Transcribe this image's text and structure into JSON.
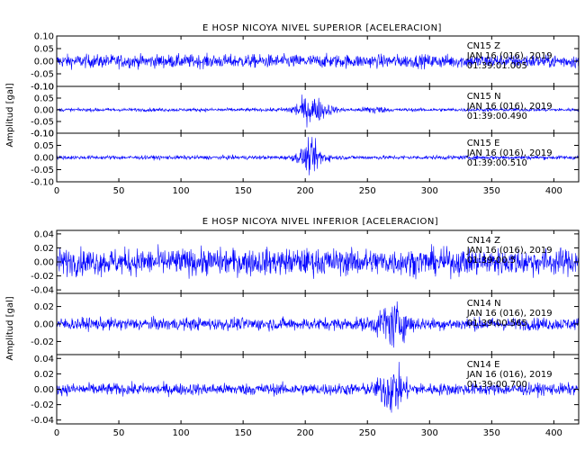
{
  "color_trace": "#0000ff",
  "color_axes": "#000000",
  "chart_data": [
    {
      "type": "line",
      "title": "E HOSP NICOYA NIVEL SUPERIOR [ACELERACION]",
      "ylabel": "Amplitud [gal]",
      "xlabel": "",
      "xlim": [
        0,
        420
      ],
      "xticks": [
        "0",
        "50",
        "100",
        "150",
        "200",
        "250",
        "300",
        "350",
        "400"
      ],
      "grid": false,
      "panels": [
        {
          "name": "CN15 Z",
          "annotation": [
            "CN15 Z",
            "JAN 16 (016), 2019",
            "01:39:01.005"
          ],
          "ylim": [
            -0.1,
            0.1
          ],
          "yticks": [
            "0.10",
            "0.05",
            "0.00",
            "-0.05",
            "-0.10"
          ],
          "noise_amplitude": 0.045,
          "events": []
        },
        {
          "name": "CN15 N",
          "annotation": [
            "CN15 N",
            "JAN 16 (016), 2019",
            "01:39:00.490"
          ],
          "ylim": [
            -0.1,
            0.1
          ],
          "yticks": [
            "0.10",
            "0.05",
            "0.00",
            "-0.05",
            "-0.10"
          ],
          "noise_amplitude": 0.012,
          "events": [
            {
              "t": 205,
              "peak": 0.09,
              "width": 14
            },
            {
              "t": 255,
              "peak": 0.025,
              "width": 8
            }
          ]
        },
        {
          "name": "CN15 E",
          "annotation": [
            "CN15 E",
            "JAN 16 (016), 2019",
            "01:39:00.510"
          ],
          "ylim": [
            -0.1,
            0.1
          ],
          "yticks": [
            "0.10",
            "0.05",
            "0.00",
            "-0.05",
            "-0.10"
          ],
          "noise_amplitude": 0.014,
          "events": [
            {
              "t": 205,
              "peak": 0.1,
              "width": 10
            }
          ]
        }
      ]
    },
    {
      "type": "line",
      "title": "E HOSP NICOYA NIVEL INFERIOR [ACELERACION]",
      "ylabel": "Amplitud [gal]",
      "xlabel": "",
      "xlim": [
        0,
        420
      ],
      "xticks": [
        "0",
        "50",
        "100",
        "150",
        "200",
        "250",
        "300",
        "350",
        "400"
      ],
      "grid": false,
      "panels": [
        {
          "name": "CN14 Z",
          "annotation": [
            "CN14 Z",
            "JAN 16 (016), 2019",
            "01:39:00.5"
          ],
          "ylim": [
            -0.045,
            0.045
          ],
          "yticks": [
            "0.04",
            "0.02",
            "0.00",
            "-0.02",
            "-0.04"
          ],
          "noise_amplitude": 0.032,
          "events": []
        },
        {
          "name": "CN14 N",
          "annotation": [
            "CN14 N",
            "JAN 16 (016), 2019",
            "01:39:00.565"
          ],
          "ylim": [
            -0.035,
            0.035
          ],
          "yticks": [
            "0.02",
            "0.00",
            "-0.02"
          ],
          "noise_amplitude": 0.012,
          "events": [
            {
              "t": 270,
              "peak": 0.035,
              "width": 12
            }
          ]
        },
        {
          "name": "CN14 E",
          "annotation": [
            "CN14 E",
            "JAN 16 (016), 2019",
            "01:39:00.700"
          ],
          "ylim": [
            -0.045,
            0.045
          ],
          "yticks": [
            "0.04",
            "0.02",
            "0.00",
            "-0.02",
            "-0.04"
          ],
          "noise_amplitude": 0.013,
          "events": [
            {
              "t": 270,
              "peak": 0.045,
              "width": 10
            }
          ]
        }
      ]
    }
  ]
}
